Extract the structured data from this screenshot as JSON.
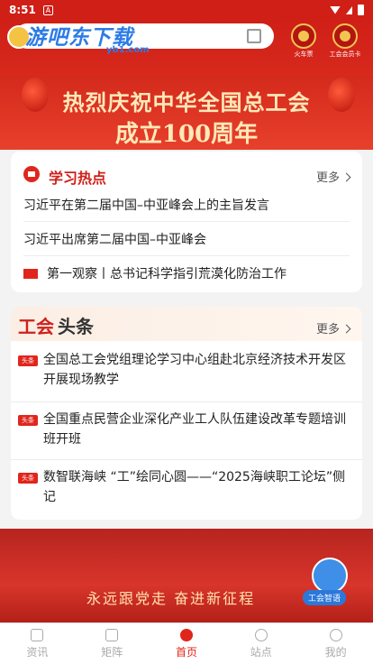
{
  "status_bar": {
    "time": "8:51",
    "notification": "A"
  },
  "header": {
    "watermark": "游吧东下载",
    "watermark_sub": "yb1.com",
    "right_buttons": [
      {
        "label": "火车票",
        "icon": "ticket-icon"
      },
      {
        "label": "工会会员卡",
        "icon": "member-card-icon"
      }
    ]
  },
  "banner": {
    "line1": "热烈庆祝中华全国总工会",
    "line2": "成立100周年"
  },
  "study": {
    "title": "学习热点",
    "more": "更多",
    "items": [
      "习近平在第二届中国–中亚峰会上的主旨发言",
      "习近平出席第二届中国–中亚峰会",
      "第一观察丨总书记科学指引荒漠化防治工作"
    ]
  },
  "union_news": {
    "title_part1": "工会",
    "title_part2": "头条",
    "more": "更多",
    "tag": "头条",
    "items": [
      "全国总工会党组理论学习中心组赴北京经济技术开发区开展现场教学",
      "全国重点民营企业深化产业工人队伍建设改革专题培训班开班",
      "数智联海峡 “工”绘同心圆——“2025海峡职工论坛”侧记"
    ]
  },
  "bottom_banner": {
    "slogan": "永远跟党走 奋进新征程"
  },
  "assistant": {
    "label": "工会智语"
  },
  "tabbar": {
    "tabs": [
      {
        "label": "资讯",
        "icon": "news-icon"
      },
      {
        "label": "矩阵",
        "icon": "matrix-icon"
      },
      {
        "label": "首页",
        "icon": "home-icon",
        "active": true
      },
      {
        "label": "站点",
        "icon": "station-icon"
      },
      {
        "label": "我的",
        "icon": "profile-icon"
      }
    ]
  },
  "colors": {
    "primary": "#e0261c",
    "header_red": "#cf1f17",
    "banner_text": "#ffe9b8"
  }
}
